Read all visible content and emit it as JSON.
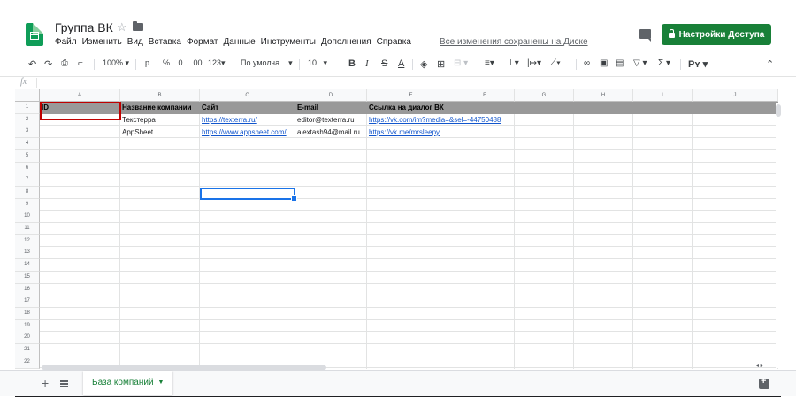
{
  "header": {
    "title": "Группа ВК",
    "menu": [
      "Файл",
      "Изменить",
      "Вид",
      "Вставка",
      "Формат",
      "Данные",
      "Инструменты",
      "Дополнения",
      "Справка"
    ],
    "saved_status": "Все изменения сохранены на Диске",
    "share_label": "Настройки Доступа",
    "share_color": "#188038"
  },
  "toolbar": {
    "zoom": "100%",
    "currency": "р.",
    "percent": "%",
    "dec_less": ".0",
    "dec_more": ".00",
    "format_more": "123",
    "font": "По умолча...",
    "font_size": "10",
    "bold": "B",
    "italic": "I",
    "strike": "S",
    "text_color": "A",
    "functions": "Σ"
  },
  "formula_bar": {
    "fx": "fx"
  },
  "grid": {
    "columns": [
      "A",
      "B",
      "C",
      "D",
      "E",
      "F",
      "G",
      "H",
      "I",
      "J"
    ],
    "rows": [
      "1",
      "2",
      "3",
      "4",
      "5",
      "6",
      "7",
      "8",
      "9",
      "10",
      "11",
      "12",
      "13",
      "14",
      "15",
      "16",
      "17",
      "18",
      "19",
      "20",
      "21",
      "22"
    ],
    "header_row_color": "#999999",
    "cells": {
      "a1": "ID",
      "b1": "Название компании",
      "c1": "Сайт",
      "d1": "E-mail",
      "e1": "Ссылка на диалог  ВК",
      "b2": "Текстерра",
      "c2": "https://texterra.ru/",
      "d2": "editor@texterra.ru",
      "e2": "https://vk.com/im?media=&sel=-44750488",
      "b3": "AppSheet",
      "c3": "https://www.appsheet.com/",
      "d3": "alextash94@mail.ru",
      "e3": "https://vk.me/mrsleepy"
    }
  },
  "sheets": {
    "active_tab": "База компаний",
    "add": "+"
  }
}
